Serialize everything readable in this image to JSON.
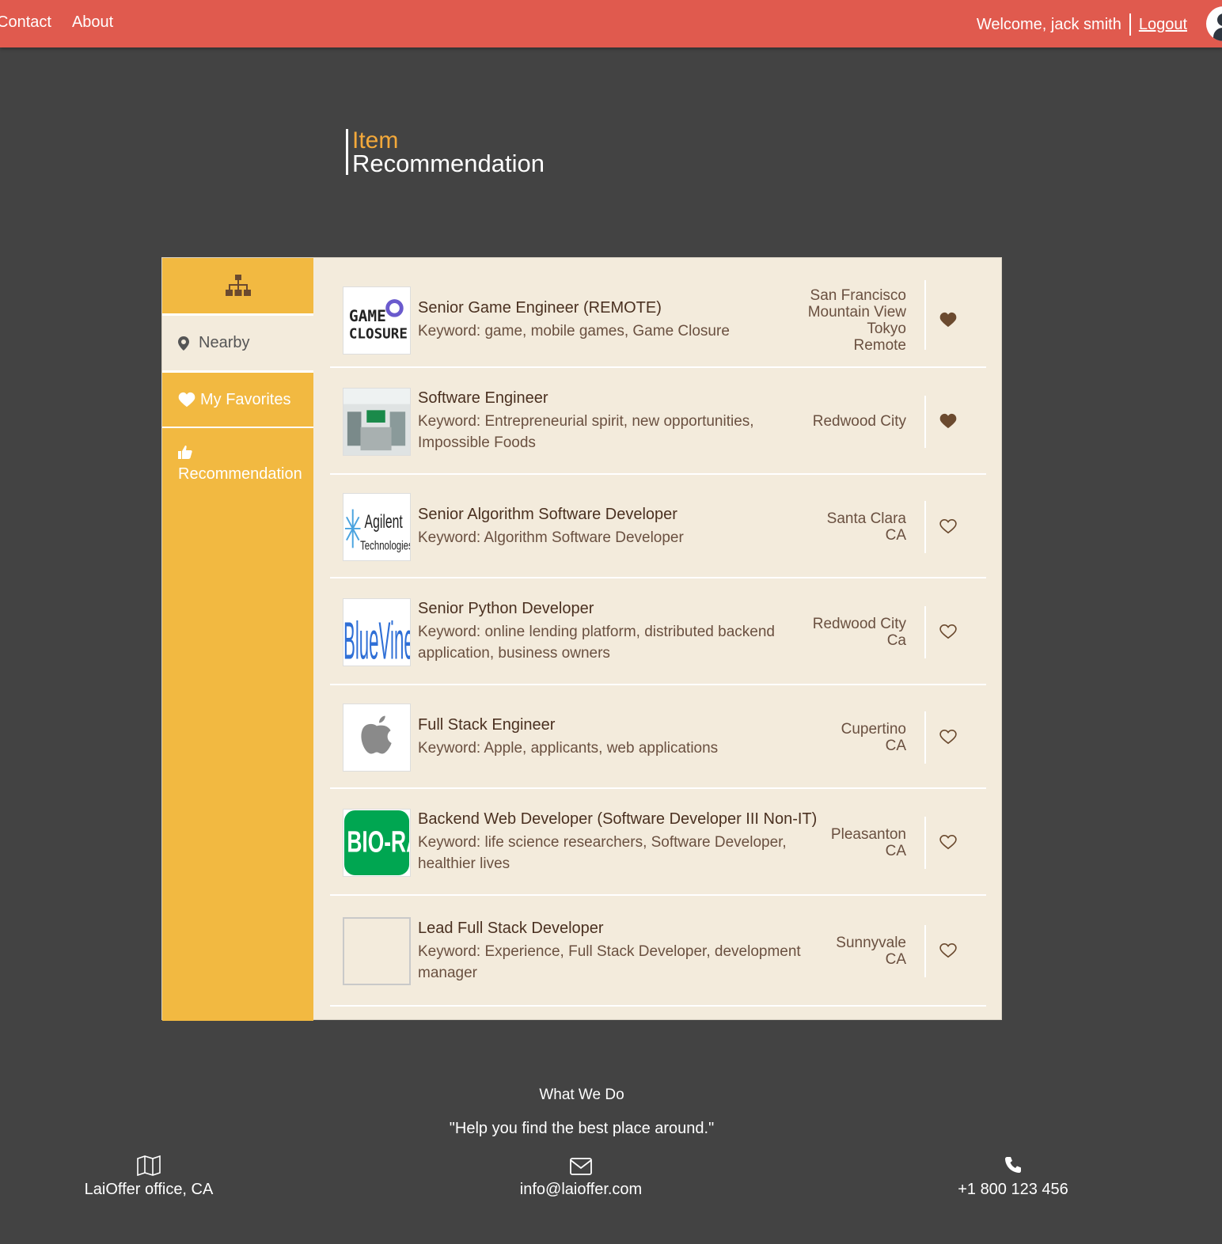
{
  "nav": {
    "links": [
      "Contact",
      "About"
    ],
    "welcome": "Welcome, jack smith",
    "logout": "Logout"
  },
  "header": {
    "title_top": "Item",
    "title_bottom": "Recommendation"
  },
  "sidebar": {
    "items": [
      {
        "label": "Nearby",
        "icon": "map-marker-icon"
      },
      {
        "label": "My Favorites",
        "icon": "heart-icon"
      },
      {
        "label": "Recommendation",
        "icon": "thumbs-up-icon"
      }
    ]
  },
  "items": [
    {
      "name": "Senior Game Engineer (REMOTE)",
      "keyword": "Keyword: game, mobile games, Game Closure",
      "location": [
        "San Francisco",
        "Mountain View",
        "Tokyo",
        "Remote"
      ],
      "favorite": true,
      "logo": "GAME CLOSURE"
    },
    {
      "name": "Software Engineer",
      "keyword": "Keyword: Entrepreneurial spirit, new opportunities, Impossible Foods",
      "location": [
        "Redwood City"
      ],
      "favorite": true,
      "logo": ""
    },
    {
      "name": "Senior Algorithm Software Developer",
      "keyword": "Keyword: Algorithm Software Developer",
      "location": [
        "Santa Clara",
        "CA"
      ],
      "favorite": false,
      "logo": "Agilent Technologies"
    },
    {
      "name": "Senior Python Developer",
      "keyword": "Keyword: online lending platform, distributed backend application, business owners",
      "location": [
        "Redwood City",
        "Ca"
      ],
      "favorite": false,
      "logo": "BlueVine"
    },
    {
      "name": "Full Stack Engineer",
      "keyword": "Keyword: Apple, applicants, web applications",
      "location": [
        "Cupertino",
        "CA"
      ],
      "favorite": false,
      "logo": ""
    },
    {
      "name": "Backend Web Developer (Software Developer III Non-IT)",
      "keyword": "Keyword: life science researchers, Software Developer, healthier lives",
      "location": [
        "Pleasanton",
        "CA"
      ],
      "favorite": false,
      "logo": "BIO-RAD"
    },
    {
      "name": "Lead Full Stack Developer",
      "keyword": "Keyword: Experience, Full Stack Developer, development manager",
      "location": [
        "Sunnyvale",
        "CA"
      ],
      "favorite": false,
      "logo": ""
    }
  ],
  "footer": {
    "title": "What We Do",
    "quote": "\"Help you find the best place around.\"",
    "address": "LaiOffer office, CA",
    "email": "info@laioffer.com",
    "phone": "+1 800 123 456"
  },
  "colors": {
    "topbar": "#e05a4e",
    "sidebar": "#f2b941",
    "panel": "#f3ebdc",
    "background": "#434343",
    "accent": "#f4a93a",
    "heart": "#6b4a2f"
  }
}
